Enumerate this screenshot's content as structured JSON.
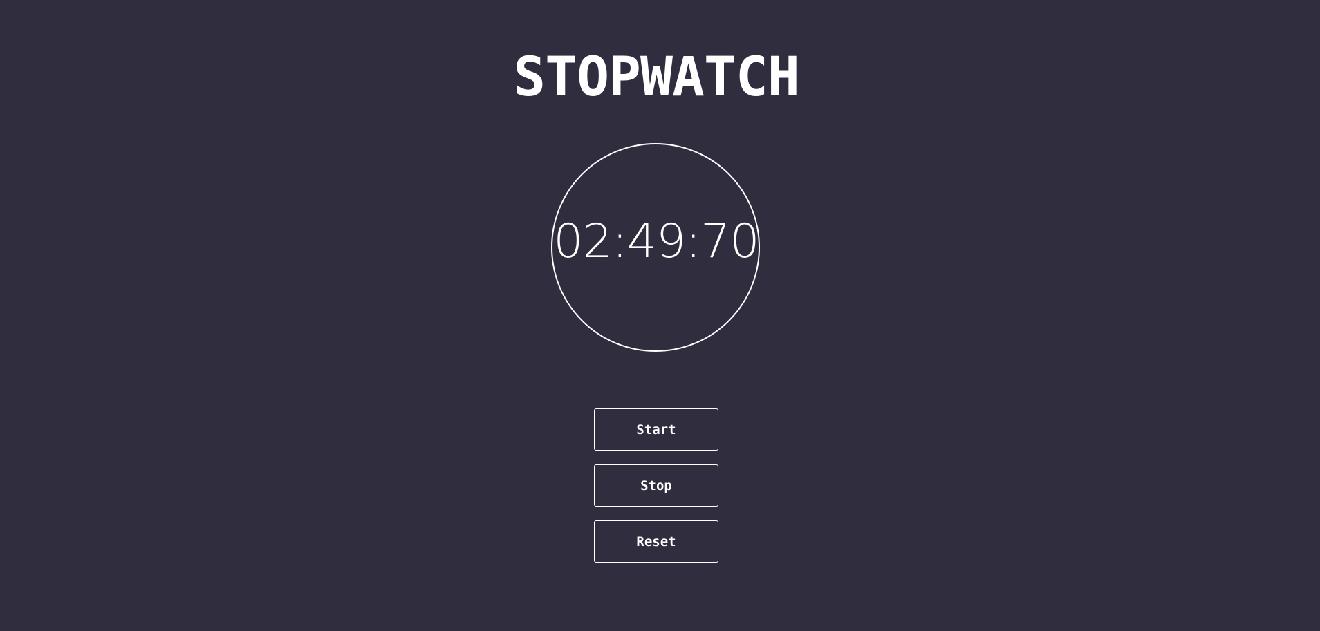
{
  "app": {
    "title": "STOPWATCH"
  },
  "timer": {
    "display": "02:49:70"
  },
  "controls": {
    "start_label": "Start",
    "stop_label": "Stop",
    "reset_label": "Reset"
  },
  "colors": {
    "background": "#302d3f",
    "foreground": "#ffffff"
  }
}
